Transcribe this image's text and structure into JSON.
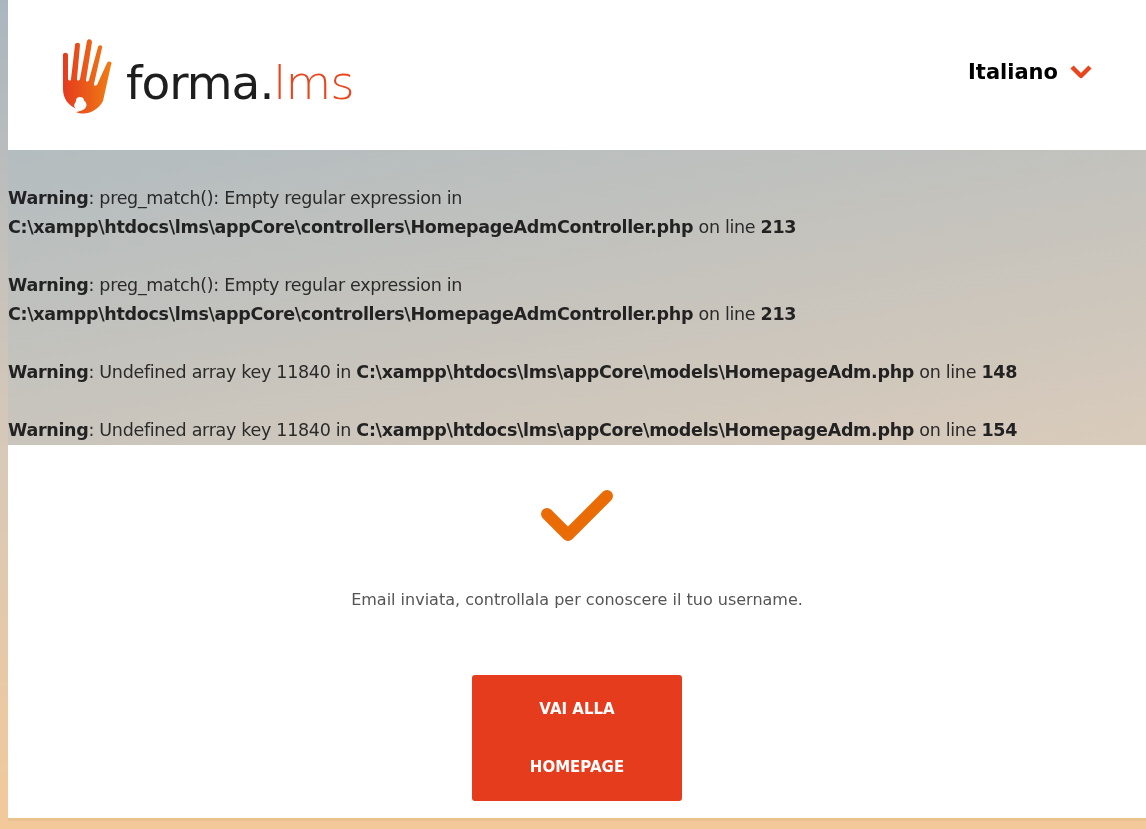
{
  "header": {
    "logo": {
      "main": "forma.",
      "accent": "lms"
    },
    "language": {
      "label": "Italiano"
    }
  },
  "warnings": [
    {
      "text": "**Warning**: preg_match(): Empty regular expression in **C:\\xampp\\htdocs\\lms\\appCore\\controllers\\HomepageAdmController.php** on line **213**"
    },
    {
      "text": "**Warning**: preg_match(): Empty regular expression in **C:\\xampp\\htdocs\\lms\\appCore\\controllers\\HomepageAdmController.php** on line **213**"
    },
    {
      "text": "**Warning**: Undefined array key 11840 in **C:\\xampp\\htdocs\\lms\\appCore\\models\\HomepageAdm.php** on line **148**"
    },
    {
      "text": "**Warning**: Undefined array key 11840 in **C:\\xampp\\htdocs\\lms\\appCore\\models\\HomepageAdm.php** on line **154**"
    }
  ],
  "result": {
    "message": "Email inviata, controllala per conoscere il tuo username.",
    "button": {
      "label_line_1": "VAI ALLA",
      "label_line_2": "HOMEPAGE"
    }
  }
}
